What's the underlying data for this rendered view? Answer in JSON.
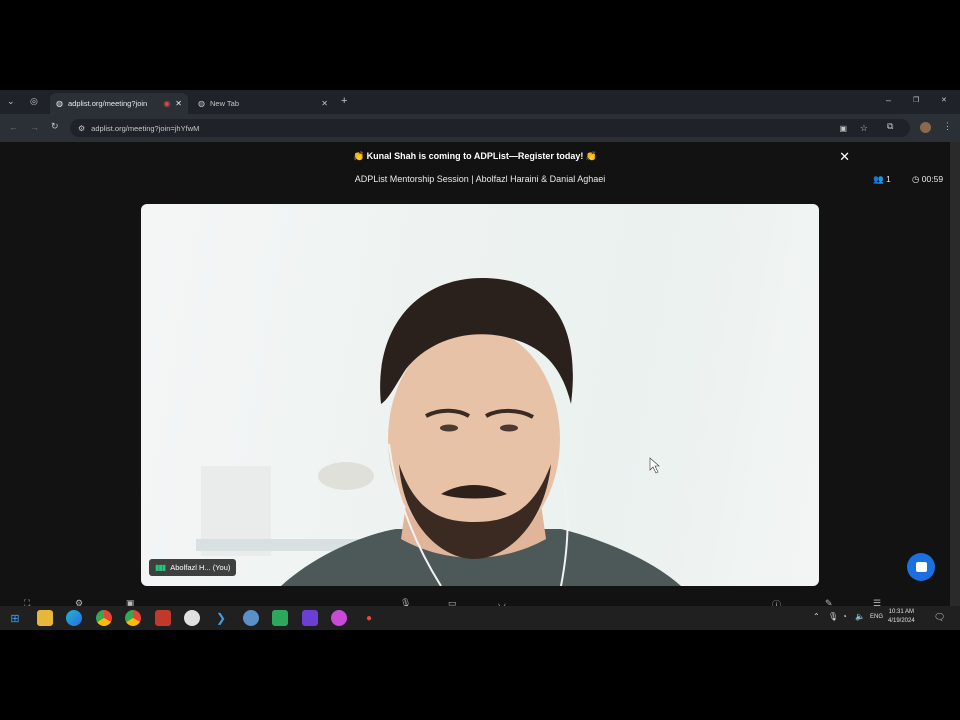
{
  "browser": {
    "tabs": [
      {
        "label": "adplist.org/meeting?join",
        "active": true
      },
      {
        "label": "New Tab",
        "active": false
      }
    ],
    "url": "adplist.org/meeting?join=jhYfwM",
    "new_tab_symbol": "+",
    "window_controls": [
      "–",
      "❐",
      "✕"
    ]
  },
  "page": {
    "banner_text": "👏 Kunal Shah is coming to ADPList—Register today! 👏",
    "session_title": "ADPList Mentorship Session | Abolfazl Haraini & Danial Aghaei",
    "participant_count": "1",
    "timer": "00:59",
    "name_tag": "Abolfazl H... (You)",
    "colors": {
      "page_bg": "#121212",
      "chat_button": "#1b6fe0",
      "speaking_indicator": "#1ec97d"
    }
  },
  "taskbar": {
    "lang": "ENG",
    "time": "10:31 AM",
    "date": "4/19/2024",
    "icons": [
      "windows-start-icon",
      "file-explorer-icon",
      "edge-icon",
      "chrome-icon",
      "chrome-alt-icon",
      "app-icon",
      "app-icon",
      "vscode-icon",
      "app-icon",
      "app-icon",
      "app-icon",
      "app-icon",
      "app-icon"
    ]
  }
}
